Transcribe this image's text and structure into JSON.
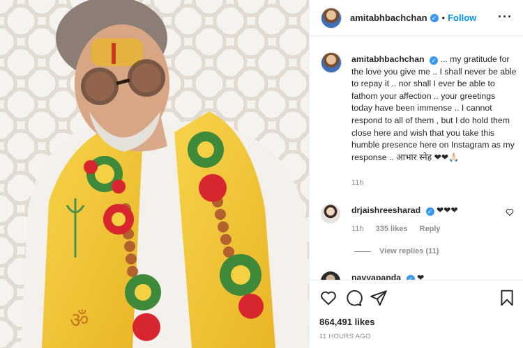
{
  "header": {
    "username": "amitabhbachchan",
    "verified_mark": "✓",
    "separator": "•",
    "follow_label": "Follow",
    "more_label": "···"
  },
  "caption": {
    "username": "amitabhbachchan",
    "verified_mark": "✓",
    "text": "... my gratitude for the love you give me .. I shall never be able to repay it .. nor shall I ever be able to fathom your affection .. your greetings today have been immense .. I cannot respond to all of them , but I do hold them close here and wish that you take this humble presence here on Instagram as my response .. आभार स्नेह ❤❤🙏🏻",
    "time": "11h"
  },
  "comments": [
    {
      "username": "drjaishreesharad",
      "verified_mark": "✓",
      "text": "❤❤❤",
      "time": "11h",
      "likes": "335 likes",
      "reply_label": "Reply",
      "view_replies": "View replies (11)"
    },
    {
      "username": "navyapanda",
      "verified_mark": "✓",
      "text": "❤"
    }
  ],
  "post": {
    "likes": "864,491 likes",
    "posted_ago": "11 HOURS AGO"
  },
  "icons": [
    "heart-icon",
    "comment-icon",
    "share-icon",
    "bookmark-icon",
    "more-icon"
  ],
  "colors": {
    "accent": "#0095f6",
    "verified": "#3897f0",
    "muted": "#8e8e8e",
    "text": "#262626"
  }
}
